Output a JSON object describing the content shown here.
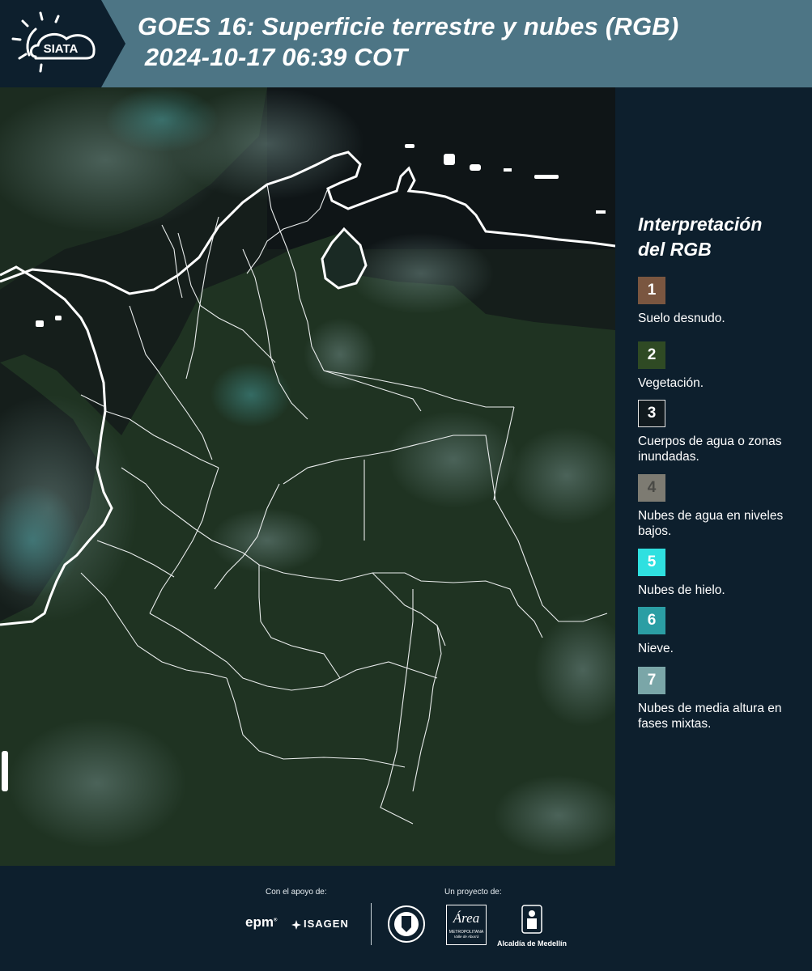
{
  "header": {
    "title": "GOES 16: Superficie terrestre y nubes (RGB)\n 2024-10-17 06:39 COT",
    "logo_text": "SIATA"
  },
  "legend": {
    "title": "Interpretación del RGB",
    "items": [
      {
        "number": "1",
        "label": "Suelo desnudo.",
        "color": "#7a5640"
      },
      {
        "number": "2",
        "label": "Vegetación.",
        "color": "#2f4a24"
      },
      {
        "number": "3",
        "label": "Cuerpos de agua o zonas inundadas.",
        "color": "#111a1f"
      },
      {
        "number": "4",
        "label": "Nubes de agua en niveles bajos.",
        "color": "#7d7b72"
      },
      {
        "number": "5",
        "label": "Nubes de hielo.",
        "color": "#2fe0e0"
      },
      {
        "number": "6",
        "label": "Nieve.",
        "color": "#2b9ea4"
      },
      {
        "number": "7",
        "label": "Nubes de media altura en fases mixtas.",
        "color": "#7aa6a8"
      }
    ]
  },
  "footer": {
    "support_label": "Con el apoyo de:",
    "project_label": "Un proyecto de:",
    "sponsors": {
      "epm": "epm",
      "isagen": "ISAGEN",
      "area_metro": "Área",
      "area_metro_sub": "METROPOLITANA",
      "area_metro_sub2": "Valle de Aburrá",
      "alcaldia": "Alcaldía de Medellín"
    }
  },
  "colors": {
    "header_bg": "#4d7585",
    "panel_bg": "#0d1f2d",
    "vegetation": "#1f3322"
  }
}
